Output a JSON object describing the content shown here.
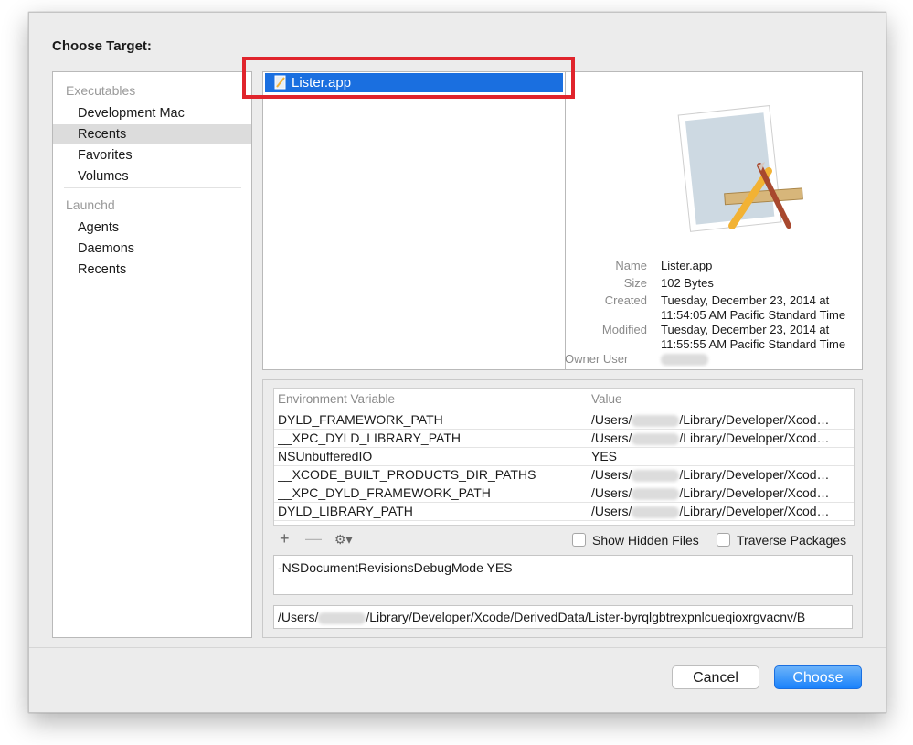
{
  "dialog": {
    "title": "Choose Target:"
  },
  "sidebar": {
    "sections": [
      {
        "header": "Executables",
        "items": [
          "Development Mac",
          "Recents",
          "Favorites",
          "Volumes"
        ]
      },
      {
        "header": "Launchd",
        "items": [
          "Agents",
          "Daemons",
          "Recents"
        ]
      }
    ],
    "selected": "Recents"
  },
  "browser": {
    "selected_file": "Lister.app"
  },
  "file_info": {
    "name_label": "Name",
    "name_value": "Lister.app",
    "size_label": "Size",
    "size_value": "102 Bytes",
    "created_label": "Created",
    "created_value_1": "Tuesday, December 23, 2014 at",
    "created_value_2": "11:54:05 AM Pacific Standard Time",
    "modified_label": "Modified",
    "modified_value_1": "Tuesday, December 23, 2014 at",
    "modified_value_2": "11:55:55 AM Pacific Standard Time",
    "owner_label": "Owner User"
  },
  "env": {
    "col_variable": "Environment Variable",
    "col_value": "Value",
    "rows": [
      {
        "name": "DYLD_FRAMEWORK_PATH",
        "value_prefix": "/Users/",
        "value_suffix": "/Library/Developer/Xcod…"
      },
      {
        "name": "__XPC_DYLD_LIBRARY_PATH",
        "value_prefix": "/Users/",
        "value_suffix": "/Library/Developer/Xcod…"
      },
      {
        "name": "NSUnbufferedIO",
        "value_prefix": "YES",
        "value_suffix": ""
      },
      {
        "name": "__XCODE_BUILT_PRODUCTS_DIR_PATHS",
        "value_prefix": "/Users/",
        "value_suffix": "/Library/Developer/Xcod…"
      },
      {
        "name": "__XPC_DYLD_FRAMEWORK_PATH",
        "value_prefix": "/Users/",
        "value_suffix": "/Library/Developer/Xcod…"
      },
      {
        "name": "DYLD_LIBRARY_PATH",
        "value_prefix": "/Users/",
        "value_suffix": "/Library/Developer/Xcod…"
      }
    ],
    "add_glyph": "+",
    "remove_glyph": "—",
    "gear_glyph": "⚙▾",
    "show_hidden_label": "Show Hidden Files",
    "traverse_label": "Traverse Packages",
    "arguments": "-NSDocumentRevisionsDebugMode YES",
    "path_prefix": "/Users/",
    "path_suffix": "/Library/Developer/Xcode/DerivedData/Lister-byrqlgbtrexpnlcueqioxrgvacnv/B"
  },
  "buttons": {
    "cancel": "Cancel",
    "choose": "Choose"
  },
  "colors": {
    "selection": "#1a6fe0",
    "highlight": "#e0242c",
    "primary_button": "#1a82fb"
  }
}
